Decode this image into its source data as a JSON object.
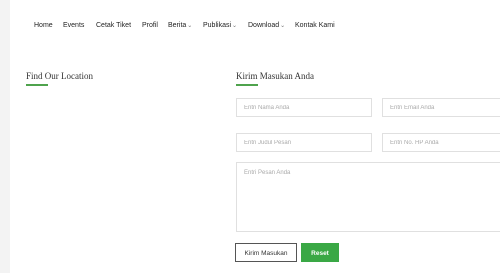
{
  "nav": {
    "items": [
      {
        "label": "Home"
      },
      {
        "label": "Events"
      },
      {
        "label": "Cetak Tiket"
      },
      {
        "label": "Profil"
      },
      {
        "label": "Berita",
        "chevron": "⌄"
      },
      {
        "label": "Publikasi",
        "chevron": "⌄"
      },
      {
        "label": "Download",
        "chevron": "⌄"
      },
      {
        "label": "Kontak Kami"
      }
    ]
  },
  "location": {
    "title": "Find Our Location"
  },
  "form": {
    "title": "Kirim Masukan Anda",
    "name_placeholder": "Entri Nama Anda",
    "email_placeholder": "Entri Email Anda",
    "subject_placeholder": "Entri Judul Pesan",
    "phone_placeholder": "Entri No. HP Anda",
    "message_placeholder": "Entri Pesan Anda",
    "submit_label": "Kirim Masukan",
    "reset_label": "Reset"
  },
  "colors": {
    "accent": "#4fa34d",
    "reset_button": "#3aa845"
  }
}
